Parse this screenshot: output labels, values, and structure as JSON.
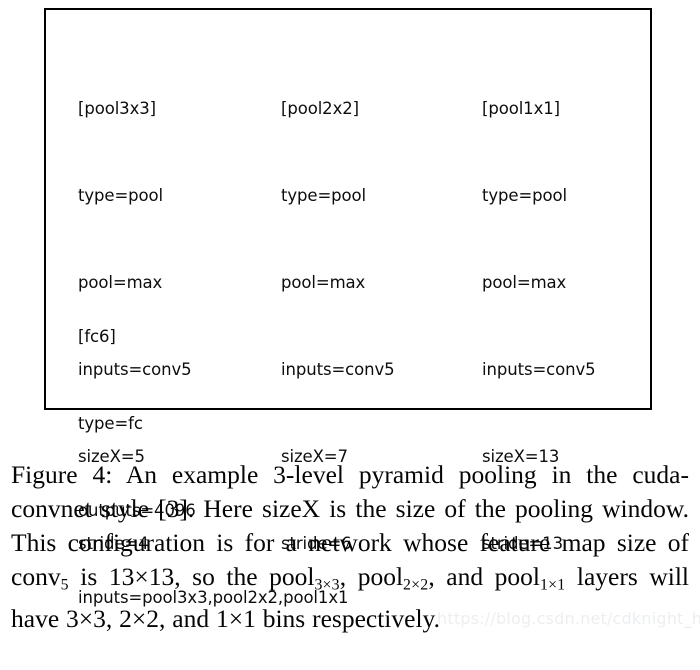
{
  "figure": {
    "config_box": {
      "columns": [
        {
          "name": "pool3x3",
          "lines": [
            "[pool3x3]",
            "type=pool",
            "pool=max",
            "inputs=conv5",
            "sizeX=5",
            "stride=4"
          ]
        },
        {
          "name": "pool2x2",
          "lines": [
            "[pool2x2]",
            "type=pool",
            "pool=max",
            "inputs=conv5",
            "sizeX=7",
            "stride=6"
          ]
        },
        {
          "name": "pool1x1",
          "lines": [
            "[pool1x1]",
            "type=pool",
            "pool=max",
            "inputs=conv5",
            "sizeX=13",
            "stride=13"
          ]
        }
      ],
      "fc6": {
        "name": "fc6",
        "lines": [
          "[fc6]",
          "type=fc",
          "outputs=4096",
          "inputs=pool3x3,pool2x2,pool1x1"
        ]
      },
      "border_color": "#000000",
      "text_color": "#0d0d0d"
    },
    "caption": {
      "label": "Figure 4:",
      "segments": [
        {
          "text": " An example 3-level pyramid pooling in the cuda-convnet style [3]. Here sizeX is the size of the pooling window. This configuration is for a network whose feature map size of conv"
        },
        {
          "sub": "5"
        },
        {
          "text": " is 13×13, so the pool"
        },
        {
          "sub": "3×3"
        },
        {
          "text": ", pool"
        },
        {
          "sub": "2×2"
        },
        {
          "text": ", and pool"
        },
        {
          "sub": "1×1"
        },
        {
          "text": " layers will have 3×3, 2×2, and 1×1 bins respectively."
        }
      ],
      "full_text": "Figure 4: An example 3-level pyramid pooling in the cuda-convnet style [3]. Here sizeX is the size of the pooling window. This configuration is for a network whose feature map size of conv5 is 13×13, so the pool3×3, pool2×2, and pool1×1 layers will have 3×3, 2×2, and 1×1 bins respectively."
    }
  },
  "watermark": {
    "text": "https://blog.csdn.net/cdknight_happy",
    "color": "#eceef0"
  }
}
